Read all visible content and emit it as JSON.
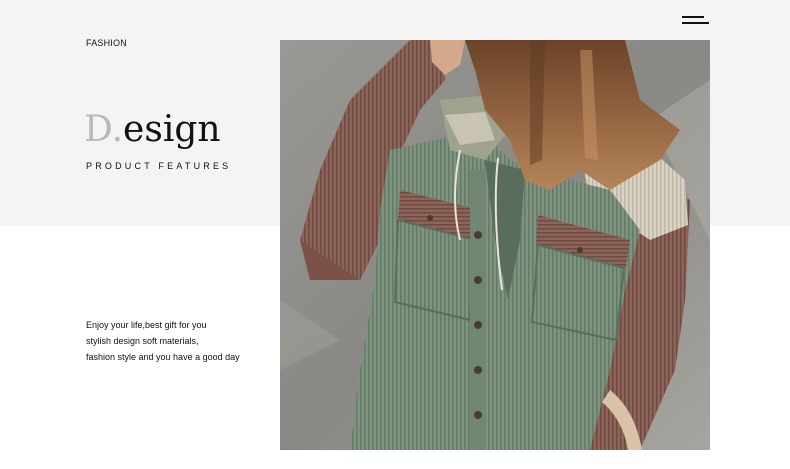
{
  "header": {
    "category": "FASHION",
    "menu_icon": "hamburger-menu-icon"
  },
  "hero": {
    "title_initial": "D",
    "title_dot": ".",
    "title_rest": "esign",
    "subtitle": "PRODUCT FEATURES"
  },
  "description": {
    "lines": [
      "Enjoy your life,best gift for you",
      "stylish design soft materials,",
      "fashion style and you have a good day"
    ]
  },
  "image": {
    "subject": "model-wearing-corduroy-jacket"
  },
  "colors": {
    "band": "#f4f4f4",
    "text": "#111111",
    "accent_gray": "#b9b9b9",
    "jacket_green": "#7e937f",
    "jacket_brown": "#8a5f55",
    "hair": "#8a5a38"
  }
}
